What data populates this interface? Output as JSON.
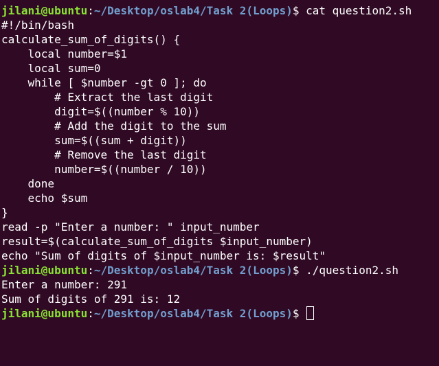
{
  "prompt": {
    "user_host": "jilani@ubuntu",
    "separator": ":",
    "path": "~/Desktop/oslab4/Task 2(Loops)",
    "symbol": "$ "
  },
  "blocks": [
    {
      "command": "cat question2.sh",
      "output": [
        "#!/bin/bash",
        "calculate_sum_of_digits() {",
        "    local number=$1",
        "    local sum=0",
        "    while [ $number -gt 0 ]; do",
        "        # Extract the last digit",
        "        digit=$((number % 10))",
        "        # Add the digit to the sum",
        "        sum=$((sum + digit))",
        "        # Remove the last digit",
        "        number=$((number / 10))",
        "    done",
        "    echo $sum",
        "}",
        "read -p \"Enter a number: \" input_number",
        "result=$(calculate_sum_of_digits $input_number)",
        "echo \"Sum of digits of $input_number is: $result\""
      ]
    },
    {
      "command": "./question2.sh",
      "output": [
        "Enter a number: 291",
        "Sum of digits of 291 is: 12"
      ]
    },
    {
      "command": "",
      "output": []
    }
  ],
  "colors": {
    "background": "#300a24",
    "user": "#8ae234",
    "path": "#729fcf",
    "text": "#ffffff"
  }
}
